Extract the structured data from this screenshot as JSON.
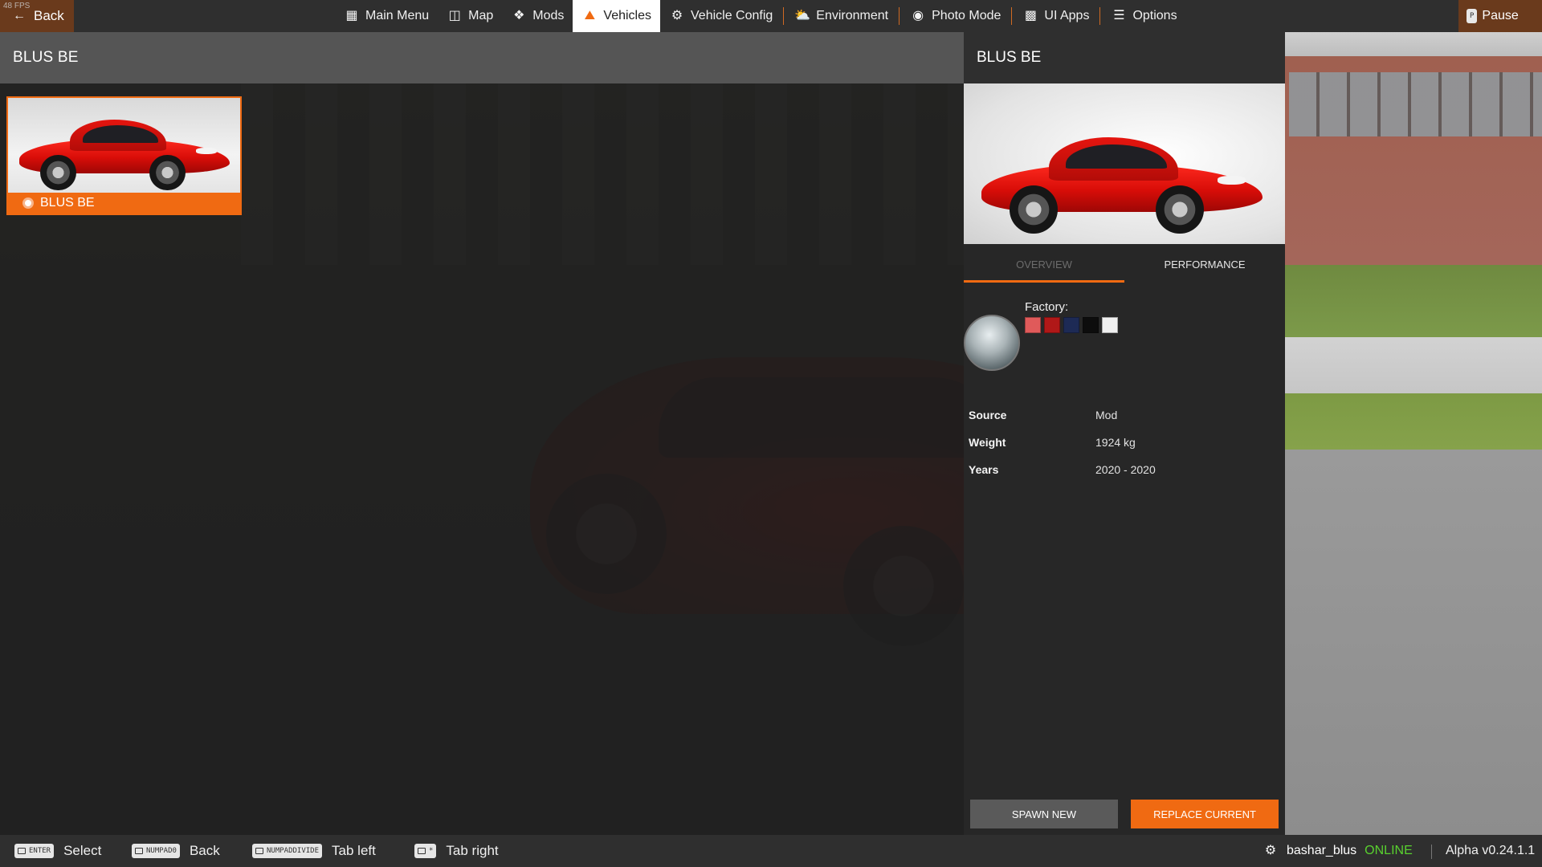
{
  "fps": "48 FPS",
  "topbar": {
    "back_label": "Back",
    "nav": [
      {
        "label": "Main Menu",
        "icon": "main-menu-icon"
      },
      {
        "label": "Map",
        "icon": "map-icon"
      },
      {
        "label": "Mods",
        "icon": "puzzle-icon"
      },
      {
        "label": "Vehicles",
        "icon": "car-icon",
        "active": true
      },
      {
        "label": "Vehicle Config",
        "icon": "engine-icon"
      },
      {
        "label": "Environment",
        "icon": "weather-icon"
      },
      {
        "label": "Photo Mode",
        "icon": "camera-icon"
      },
      {
        "label": "UI Apps",
        "icon": "ui-apps-icon"
      },
      {
        "label": "Options",
        "icon": "options-icon"
      }
    ],
    "pause_key": "P",
    "pause_label": "Pause"
  },
  "list": {
    "title": "BLUS BE",
    "tiles": [
      {
        "label": "BLUS BE",
        "mod": true
      }
    ]
  },
  "detail": {
    "title": "BLUS BE",
    "tabs": [
      "OVERVIEW",
      "PERFORMANCE"
    ],
    "active_tab": "OVERVIEW",
    "factory_label": "Factory:",
    "factory_colors": [
      "#e05a5a",
      "#b01818",
      "#1d2a55",
      "#0d0d0d",
      "#f0f0f0"
    ],
    "info": [
      {
        "key": "Source",
        "value": "Mod"
      },
      {
        "key": "Weight",
        "value": "1924 kg"
      },
      {
        "key": "Years",
        "value": "2020 - 2020"
      }
    ],
    "spawn_label": "SPAWN NEW",
    "replace_label": "REPLACE CURRENT"
  },
  "bottombar": {
    "hints": [
      {
        "key": "ENTER",
        "label": "Select"
      },
      {
        "key": "NUMPAD0",
        "label": "Back"
      },
      {
        "key": "NUMPADDIVIDE",
        "label": "Tab left"
      },
      {
        "key": "*",
        "label": "Tab right"
      }
    ],
    "username": "bashar_blus",
    "status": "ONLINE",
    "version": "Alpha v0.24.1.1"
  },
  "colors": {
    "accent": "#f06a12",
    "online": "#59d12f"
  }
}
